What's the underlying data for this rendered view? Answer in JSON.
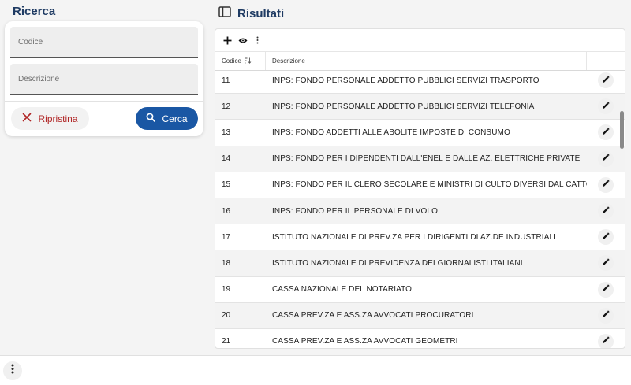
{
  "search": {
    "title": "Ricerca",
    "codice_placeholder": "Codice",
    "descrizione_placeholder": "Descrizione",
    "reset_label": "Ripristina",
    "search_label": "Cerca"
  },
  "results": {
    "title": "Risultati",
    "columns": {
      "codice": "Codice",
      "descrizione": "Descrizione"
    },
    "rows": [
      {
        "codice": "11",
        "descrizione": "INPS: FONDO PERSONALE ADDETTO PUBBLICI SERVIZI TRASPORTO"
      },
      {
        "codice": "12",
        "descrizione": "INPS: FONDO PERSONALE ADDETTO PUBBLICI SERVIZI TELEFONIA"
      },
      {
        "codice": "13",
        "descrizione": "INPS: FONDO ADDETTI ALLE ABOLITE IMPOSTE DI CONSUMO"
      },
      {
        "codice": "14",
        "descrizione": "INPS: FONDO PER I DIPENDENTI DALL'ENEL E DALLE AZ. ELETTRICHE PRIVATE"
      },
      {
        "codice": "15",
        "descrizione": "INPS: FONDO PER IL CLERO SECOLARE E MINISTRI DI CULTO DIVERSI DAL CATTOLI"
      },
      {
        "codice": "16",
        "descrizione": "INPS: FONDO PER IL PERSONALE DI VOLO"
      },
      {
        "codice": "17",
        "descrizione": "ISTITUTO NAZIONALE DI PREV.ZA PER I DIRIGENTI DI AZ.DE INDUSTRIALI"
      },
      {
        "codice": "18",
        "descrizione": "ISTITUTO NAZIONALE DI PREVIDENZA DEI GIORNALISTI ITALIANI"
      },
      {
        "codice": "19",
        "descrizione": "CASSA NAZIONALE DEL NOTARIATO"
      },
      {
        "codice": "20",
        "descrizione": "CASSA PREV.ZA E ASS.ZA AVVOCATI PROCURATORI"
      },
      {
        "codice": "21",
        "descrizione": "CASSA PREV.ZA E ASS.ZA AVVOCATI GEOMETRI"
      }
    ]
  },
  "icons": {
    "panel": "panel-icon",
    "add": "plus-icon",
    "view": "eye-icon",
    "menu": "more-vertical-icon",
    "sort": "sort-descending-icon",
    "edit": "pencil-icon",
    "reset": "close-icon",
    "search": "search-icon"
  },
  "colors": {
    "title": "#1f3b63",
    "primary": "#1a57a4",
    "danger": "#b02525"
  }
}
